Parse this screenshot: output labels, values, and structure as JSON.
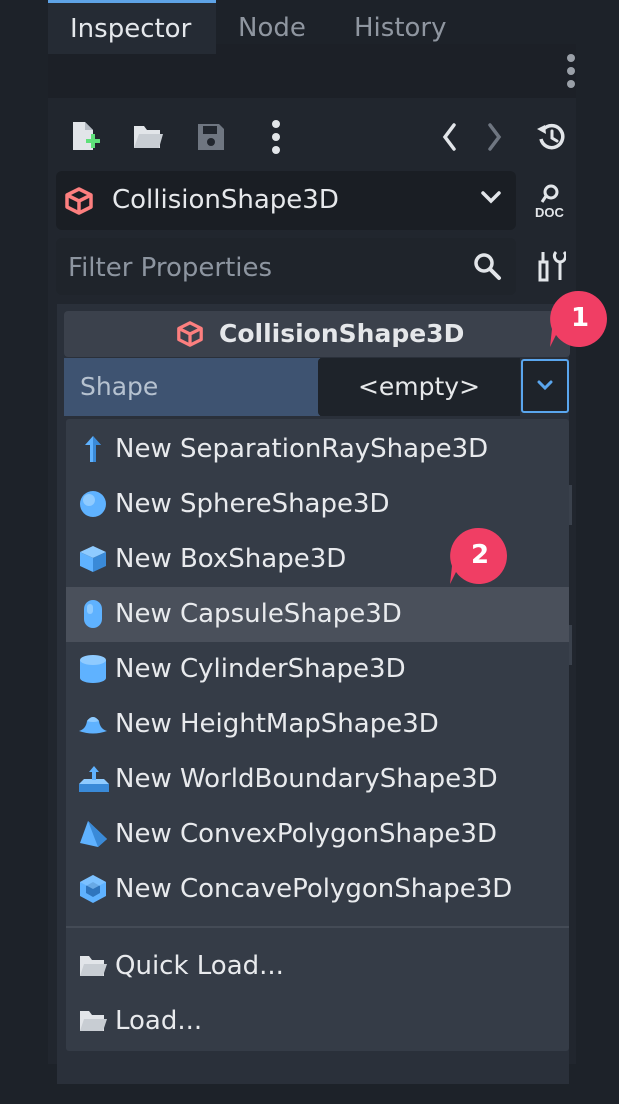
{
  "tabs": [
    {
      "label": "Inspector",
      "active": true
    },
    {
      "label": "Node",
      "active": false
    },
    {
      "label": "History",
      "active": false
    }
  ],
  "node_selector": {
    "label": "CollisionShape3D"
  },
  "filter": {
    "placeholder": "Filter Properties"
  },
  "section": {
    "title": "CollisionShape3D"
  },
  "property": {
    "label": "Shape",
    "value": "<empty>"
  },
  "menu": {
    "items": [
      {
        "label": "New SeparationRayShape3D",
        "icon": "separation-ray-icon"
      },
      {
        "label": "New SphereShape3D",
        "icon": "sphere-icon"
      },
      {
        "label": "New BoxShape3D",
        "icon": "box-icon"
      },
      {
        "label": "New CapsuleShape3D",
        "icon": "capsule-icon",
        "highlighted": true
      },
      {
        "label": "New CylinderShape3D",
        "icon": "cylinder-icon"
      },
      {
        "label": "New HeightMapShape3D",
        "icon": "heightmap-icon"
      },
      {
        "label": "New WorldBoundaryShape3D",
        "icon": "world-boundary-icon"
      },
      {
        "label": "New ConvexPolygonShape3D",
        "icon": "convex-polygon-icon"
      },
      {
        "label": "New ConcavePolygonShape3D",
        "icon": "concave-polygon-icon"
      }
    ],
    "load_items": [
      {
        "label": "Quick Load...",
        "icon": "folder-icon"
      },
      {
        "label": "Load...",
        "icon": "folder-icon"
      }
    ]
  },
  "badges": [
    "1",
    "2"
  ],
  "colors": {
    "accent": "#5aa6ee",
    "node_icon": "#fc7f7f",
    "shape_icon": "#5fb2ff",
    "badge": "#f03e64"
  }
}
